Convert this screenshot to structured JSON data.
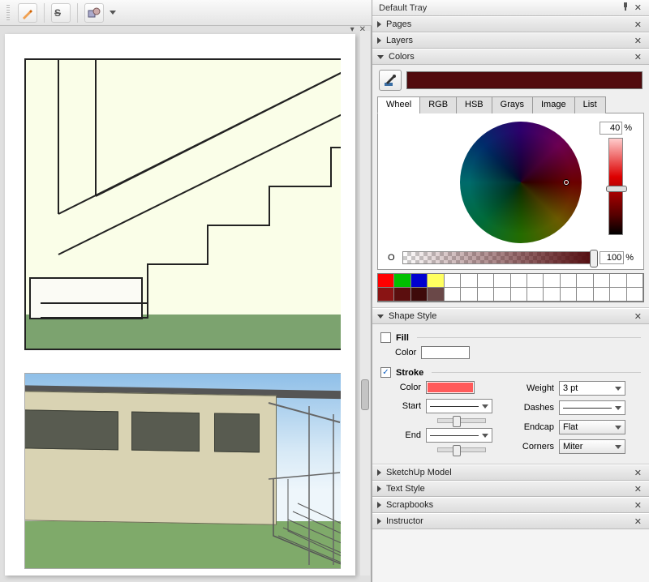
{
  "tray": {
    "title": "Default Tray",
    "panels": [
      {
        "id": "pages",
        "label": "Pages",
        "expanded": false
      },
      {
        "id": "layers",
        "label": "Layers",
        "expanded": false
      },
      {
        "id": "colors",
        "label": "Colors",
        "expanded": true
      },
      {
        "id": "shape",
        "label": "Shape Style",
        "expanded": true
      },
      {
        "id": "sketchup",
        "label": "SketchUp Model",
        "expanded": false
      },
      {
        "id": "textstyle",
        "label": "Text Style",
        "expanded": false
      },
      {
        "id": "scrapbooks",
        "label": "Scrapbooks",
        "expanded": false
      },
      {
        "id": "instructor",
        "label": "Instructor",
        "expanded": false
      }
    ]
  },
  "colors": {
    "current": "#520b0e",
    "tabs": [
      "Wheel",
      "RGB",
      "HSB",
      "Grays",
      "Image",
      "List"
    ],
    "active_tab": "Wheel",
    "value_percent": "40",
    "opacity_label": "O",
    "opacity_percent": "100",
    "percent_symbol": "%",
    "swatches_row1": [
      "#ff0000",
      "#00c000",
      "#0000d0",
      "#ffff60",
      "#ffffff",
      "#ffffff",
      "#ffffff",
      "#ffffff",
      "#ffffff",
      "#ffffff",
      "#ffffff",
      "#ffffff",
      "#ffffff",
      "#ffffff",
      "#ffffff",
      "#ffffff"
    ],
    "swatches_row2": [
      "#8a1414",
      "#5b0e0e",
      "#3e0a0a",
      "#6a4848",
      "#ffffff",
      "#ffffff",
      "#ffffff",
      "#ffffff",
      "#ffffff",
      "#ffffff",
      "#ffffff",
      "#ffffff",
      "#ffffff",
      "#ffffff",
      "#ffffff",
      "#ffffff"
    ]
  },
  "shape": {
    "fill_label": "Fill",
    "fill_checked": false,
    "fill_color_label": "Color",
    "fill_color": "#ffffff",
    "stroke_label": "Stroke",
    "stroke_checked": true,
    "stroke_color_label": "Color",
    "stroke_color": "#ff5a5a",
    "weight_label": "Weight",
    "weight_value": "3 pt",
    "start_label": "Start",
    "dashes_label": "Dashes",
    "end_label": "End",
    "endcap_label": "Endcap",
    "endcap_value": "Flat",
    "corners_label": "Corners",
    "corners_value": "Miter"
  }
}
